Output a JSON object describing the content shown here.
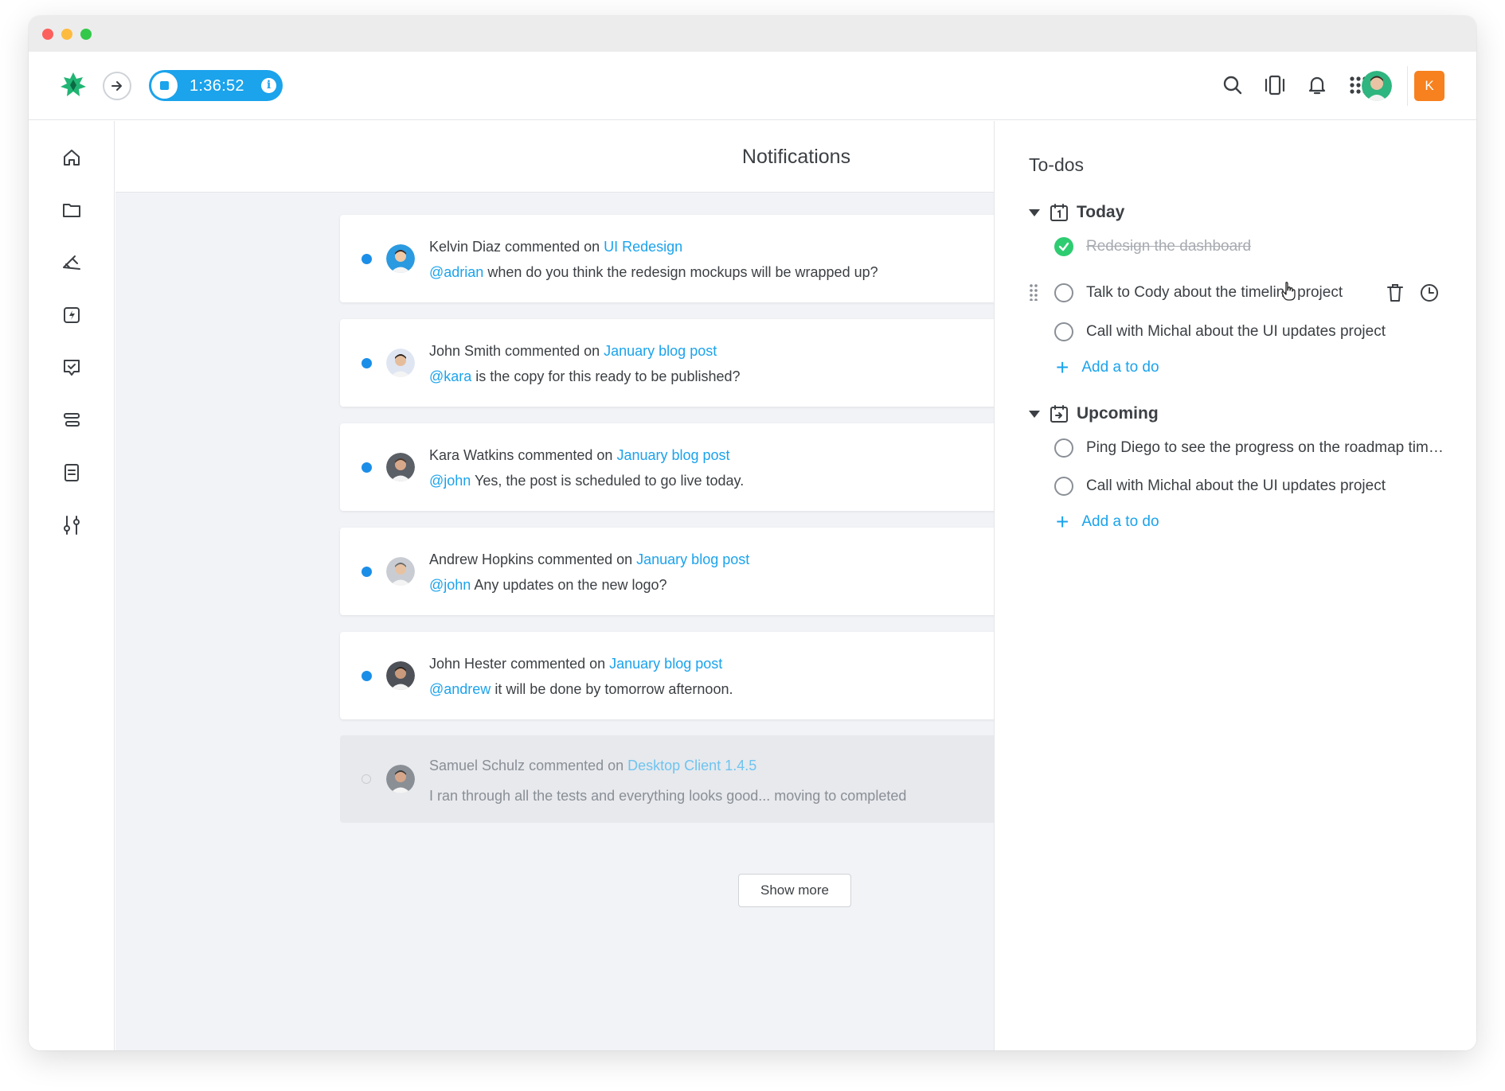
{
  "timer": {
    "time": "1:36:52",
    "info_label": "i"
  },
  "header": {
    "org_initial": "K"
  },
  "notifications": {
    "title": "Notifications",
    "items": [
      {
        "author": "Kelvin Diaz",
        "verb": " commented on ",
        "target": "UI Redesign",
        "mention": "@adrian",
        "message": " when do you think the redesign mockups will be wrapped up?",
        "unread": true
      },
      {
        "author": "John Smith",
        "verb": " commented on ",
        "target": "January blog post",
        "mention": "@kara",
        "message": " is the copy for this ready to be published?",
        "unread": true
      },
      {
        "author": "Kara Watkins",
        "verb": " commented on ",
        "target": "January blog post",
        "mention": "@john",
        "message": " Yes, the post is scheduled to go live today.",
        "unread": true
      },
      {
        "author": "Andrew Hopkins",
        "verb": " commented on ",
        "target": "January blog post",
        "mention": "@john",
        "message": " Any updates on the new logo?",
        "unread": true
      },
      {
        "author": "John Hester",
        "verb": " commented on ",
        "target": "January blog post",
        "mention": "@andrew",
        "message": " it will be done by tomorrow afternoon.",
        "unread": true
      },
      {
        "author": "Samuel Schulz",
        "verb": " commented on ",
        "target": "Desktop Client 1.4.5",
        "mention": "",
        "message": "I ran through all the tests and everything looks good... moving to completed",
        "unread": false
      }
    ],
    "show_more": "Show more"
  },
  "todos": {
    "title": "To-dos",
    "today": {
      "label": "Today",
      "items": [
        {
          "text": "Redesign the dashboard",
          "done": true
        },
        {
          "text": "Talk to Cody about the timeline project",
          "done": false
        },
        {
          "text": "Call with Michal about the UI updates project",
          "done": false
        }
      ],
      "add_label": "Add a to do"
    },
    "upcoming": {
      "label": "Upcoming",
      "items": [
        {
          "text": "Ping Diego to see the progress on the roadmap timeline",
          "done": false
        },
        {
          "text": "Call with Michal about the UI updates project",
          "done": false
        }
      ],
      "add_label": "Add a to do"
    }
  },
  "colors": {
    "accent": "#1ba3ec",
    "unread_dot": "#1b8ee8",
    "done_green": "#2ecc71",
    "org_badge": "#f7811e"
  },
  "icons": [
    "home-icon",
    "folder-icon",
    "projects-icon",
    "activity-icon",
    "tasks-icon",
    "timeline-icon",
    "reports-icon",
    "settings-icon",
    "search-icon",
    "timesheet-icon",
    "bell-icon",
    "apps-grid-icon",
    "trash-icon",
    "clock-icon"
  ]
}
